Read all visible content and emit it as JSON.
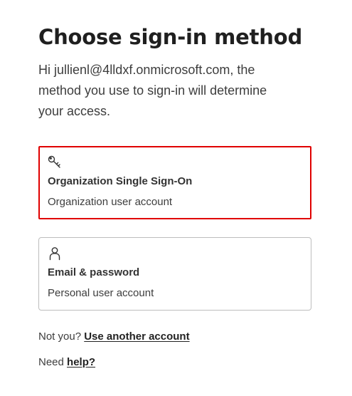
{
  "page": {
    "title": "Choose sign-in method",
    "intro": "Hi jullienl@4lldxf.onmicrosoft.com, the method you use to sign-in will determine your access."
  },
  "options": [
    {
      "icon": "key-icon",
      "title": "Organization Single Sign-On",
      "subtitle": "Organization user account",
      "selected": true
    },
    {
      "icon": "person-icon",
      "title": "Email & password",
      "subtitle": "Personal user account",
      "selected": false
    }
  ],
  "footer": {
    "not_you_prefix": "Not you?",
    "use_another_account": "Use another account",
    "need_prefix": "Need",
    "help": "help?"
  },
  "colors": {
    "selected_border": "#e00000",
    "card_border": "#bdbdbd",
    "text": "#3d3d3d"
  }
}
